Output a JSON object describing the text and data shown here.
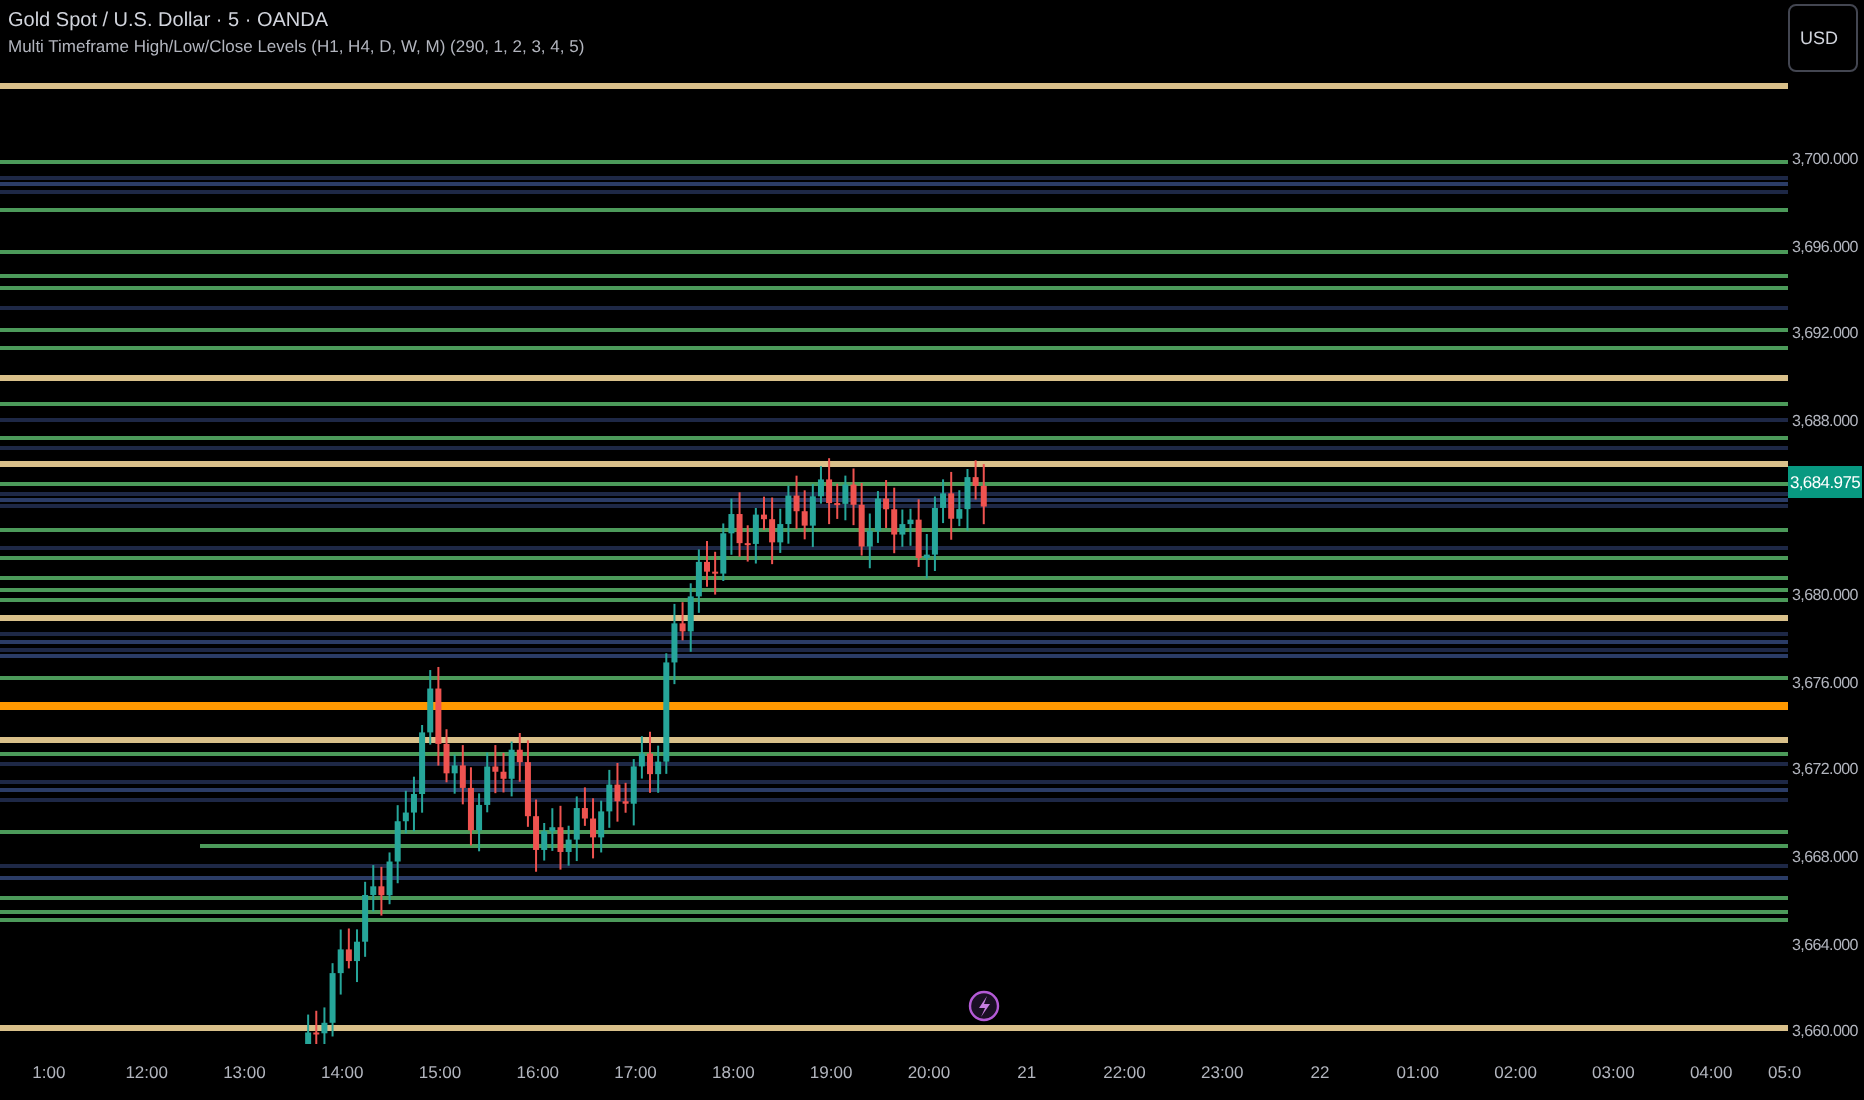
{
  "legend": {
    "title": "Gold Spot / U.S. Dollar · 5 · OANDA",
    "indicator": "Multi Timeframe High/Low/Close Levels (H1, H4, D, W, M) (290, 1, 2, 3, 4, 5)"
  },
  "price_axis": {
    "currency_button": "USD",
    "last_price": "3,684.975",
    "ticks_above": [
      "3,700.000",
      "3,696.000",
      "3,692.000",
      "3,688.000"
    ],
    "ticks_below": [
      "3,680.000",
      "3,676.000",
      "3,672.000",
      "3,668.000",
      "3,664.000",
      "3,660.000"
    ]
  },
  "time_axis": {
    "ticks": [
      "1:00",
      "12:00",
      "13:00",
      "14:00",
      "15:00",
      "16:00",
      "17:00",
      "18:00",
      "19:00",
      "20:00",
      "21",
      "22:00",
      "23:00",
      "22",
      "01:00",
      "02:00",
      "03:00",
      "04:00",
      "05:0"
    ]
  }
}
